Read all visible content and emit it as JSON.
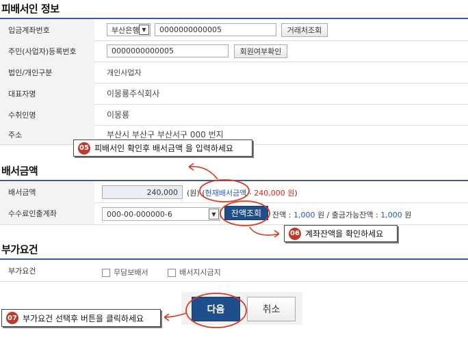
{
  "sections": {
    "payee": "피배서인 정보",
    "amount": "배서금액",
    "extra": "부가요건"
  },
  "payee": {
    "account_label": "입금계좌번호",
    "bank": "부산은행",
    "account_value": "0000000000005",
    "lookup_button": "거래처조회",
    "regno_label": "주민(사업자)등록번호",
    "regno_value": "0000000000005",
    "member_check_button": "회원여부확인",
    "type_label": "법인/개인구분",
    "type_value": "개인사업자",
    "rep_label": "대표자명",
    "rep_value": "이몽룡주식회사",
    "recipient_label": "수취인명",
    "recipient_value": "이몽룡",
    "address_label": "주소",
    "address_value": "부산시 부산구 부산서구 000 번지"
  },
  "amount": {
    "amount_label": "배서금액",
    "amount_value": "240,000",
    "unit": "(원)",
    "current_prefix": "(",
    "current_label": "현재배서금액",
    "current_dash": " - ",
    "current_value": "240,000 원",
    "current_suffix": ")",
    "fee_label": "수수료인출계좌",
    "fee_account": "000-00-000000-6",
    "balance_button": "잔액조회",
    "balance_label": "잔액 : ",
    "balance_value": "1,000",
    "withdrawable_label": " 원 / 출금가능잔액 : ",
    "withdrawable_value": "1,000",
    "won": " 원"
  },
  "extra": {
    "label": "부가요건",
    "option1": "무담보배서",
    "option2": "배서지시금지"
  },
  "actions": {
    "next": "다음",
    "cancel": "취소"
  },
  "callouts": {
    "c5_num": "05",
    "c5_text": "피배서인 확인후 배서금액 을 입력하세요",
    "c6_num": "06",
    "c6_text": "계좌잔액을 확인하세요",
    "c7_num": "07",
    "c7_text": "부가요건 선택후 버튼을 클릭하세요"
  },
  "colors": {
    "accent": "#3b5aa0",
    "highlight": "#d9381e",
    "primary_btn": "#1f4e8c"
  }
}
